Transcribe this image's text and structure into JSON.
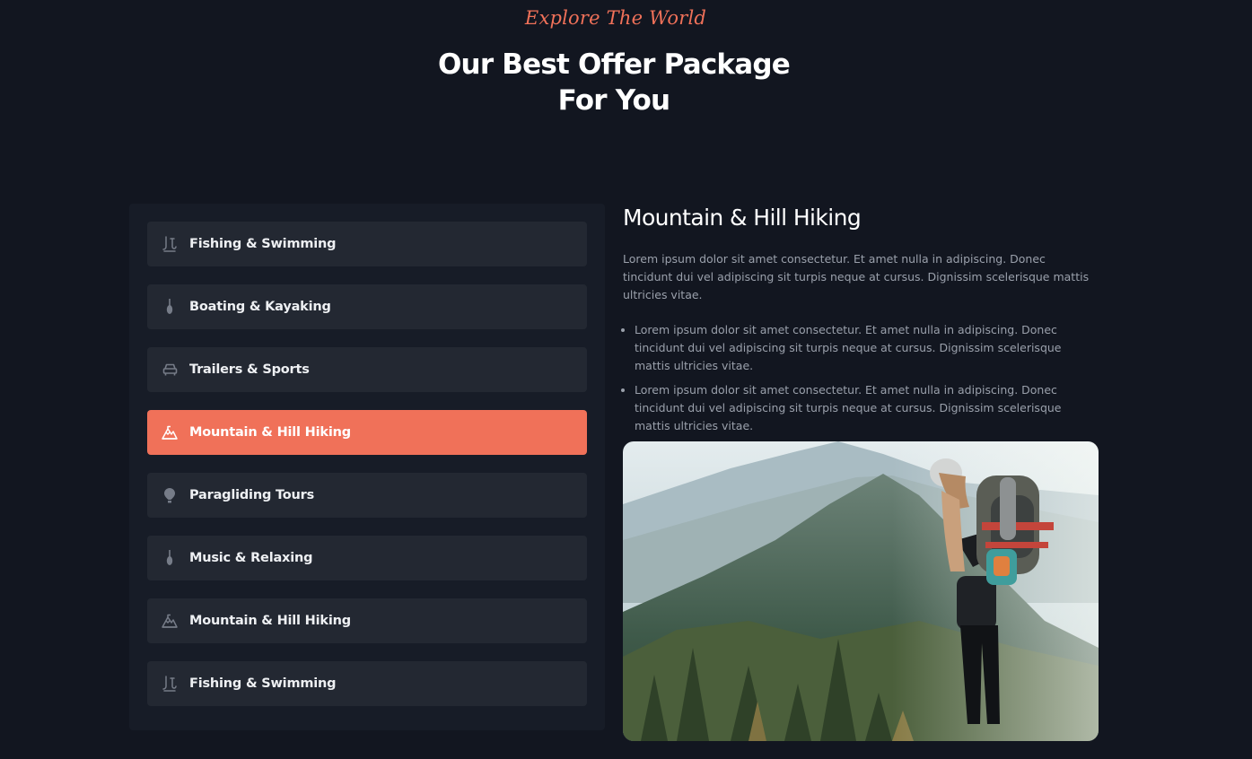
{
  "header": {
    "eyebrow": "Explore The World",
    "title_line1": "Our Best Offer Package",
    "title_line2": "For You"
  },
  "tabs": [
    {
      "label": "Fishing & Swimming",
      "icon": "fishing-icon",
      "active": false
    },
    {
      "label": "Boating & Kayaking",
      "icon": "paddle-icon",
      "active": false
    },
    {
      "label": "Trailers & Sports",
      "icon": "car-icon",
      "active": false
    },
    {
      "label": "Mountain & Hill Hiking",
      "icon": "mountain-icon",
      "active": true
    },
    {
      "label": "Paragliding Tours",
      "icon": "balloon-icon",
      "active": false
    },
    {
      "label": "Music & Relaxing",
      "icon": "guitar-icon",
      "active": false
    },
    {
      "label": "Mountain & Hill Hiking",
      "icon": "mountain-icon",
      "active": false
    },
    {
      "label": "Fishing & Swimming",
      "icon": "fishing-icon",
      "active": false
    }
  ],
  "content": {
    "title": "Mountain & Hill Hiking",
    "paragraph": "Lorem ipsum dolor sit amet consectetur. Et amet nulla in adipiscing. Donec tincidunt dui vel adipiscing sit turpis neque at cursus. Dignissim scelerisque mattis ultricies vitae.",
    "bullets": [
      "Lorem ipsum dolor sit amet consectetur. Et amet nulla in adipiscing. Donec tincidunt dui vel adipiscing sit turpis neque at cursus. Dignissim scelerisque mattis ultricies vitae.",
      "Lorem ipsum dolor sit amet consectetur. Et amet nulla in adipiscing. Donec tincidunt dui vel adipiscing sit turpis neque at cursus. Dignissim scelerisque mattis ultricies vitae."
    ],
    "image": "hiker-on-mountain-photo"
  },
  "colors": {
    "background": "#121620",
    "panel": "#171c27",
    "tab": "#232832",
    "accent": "#f07159",
    "muted_text": "#9aa0ab"
  }
}
